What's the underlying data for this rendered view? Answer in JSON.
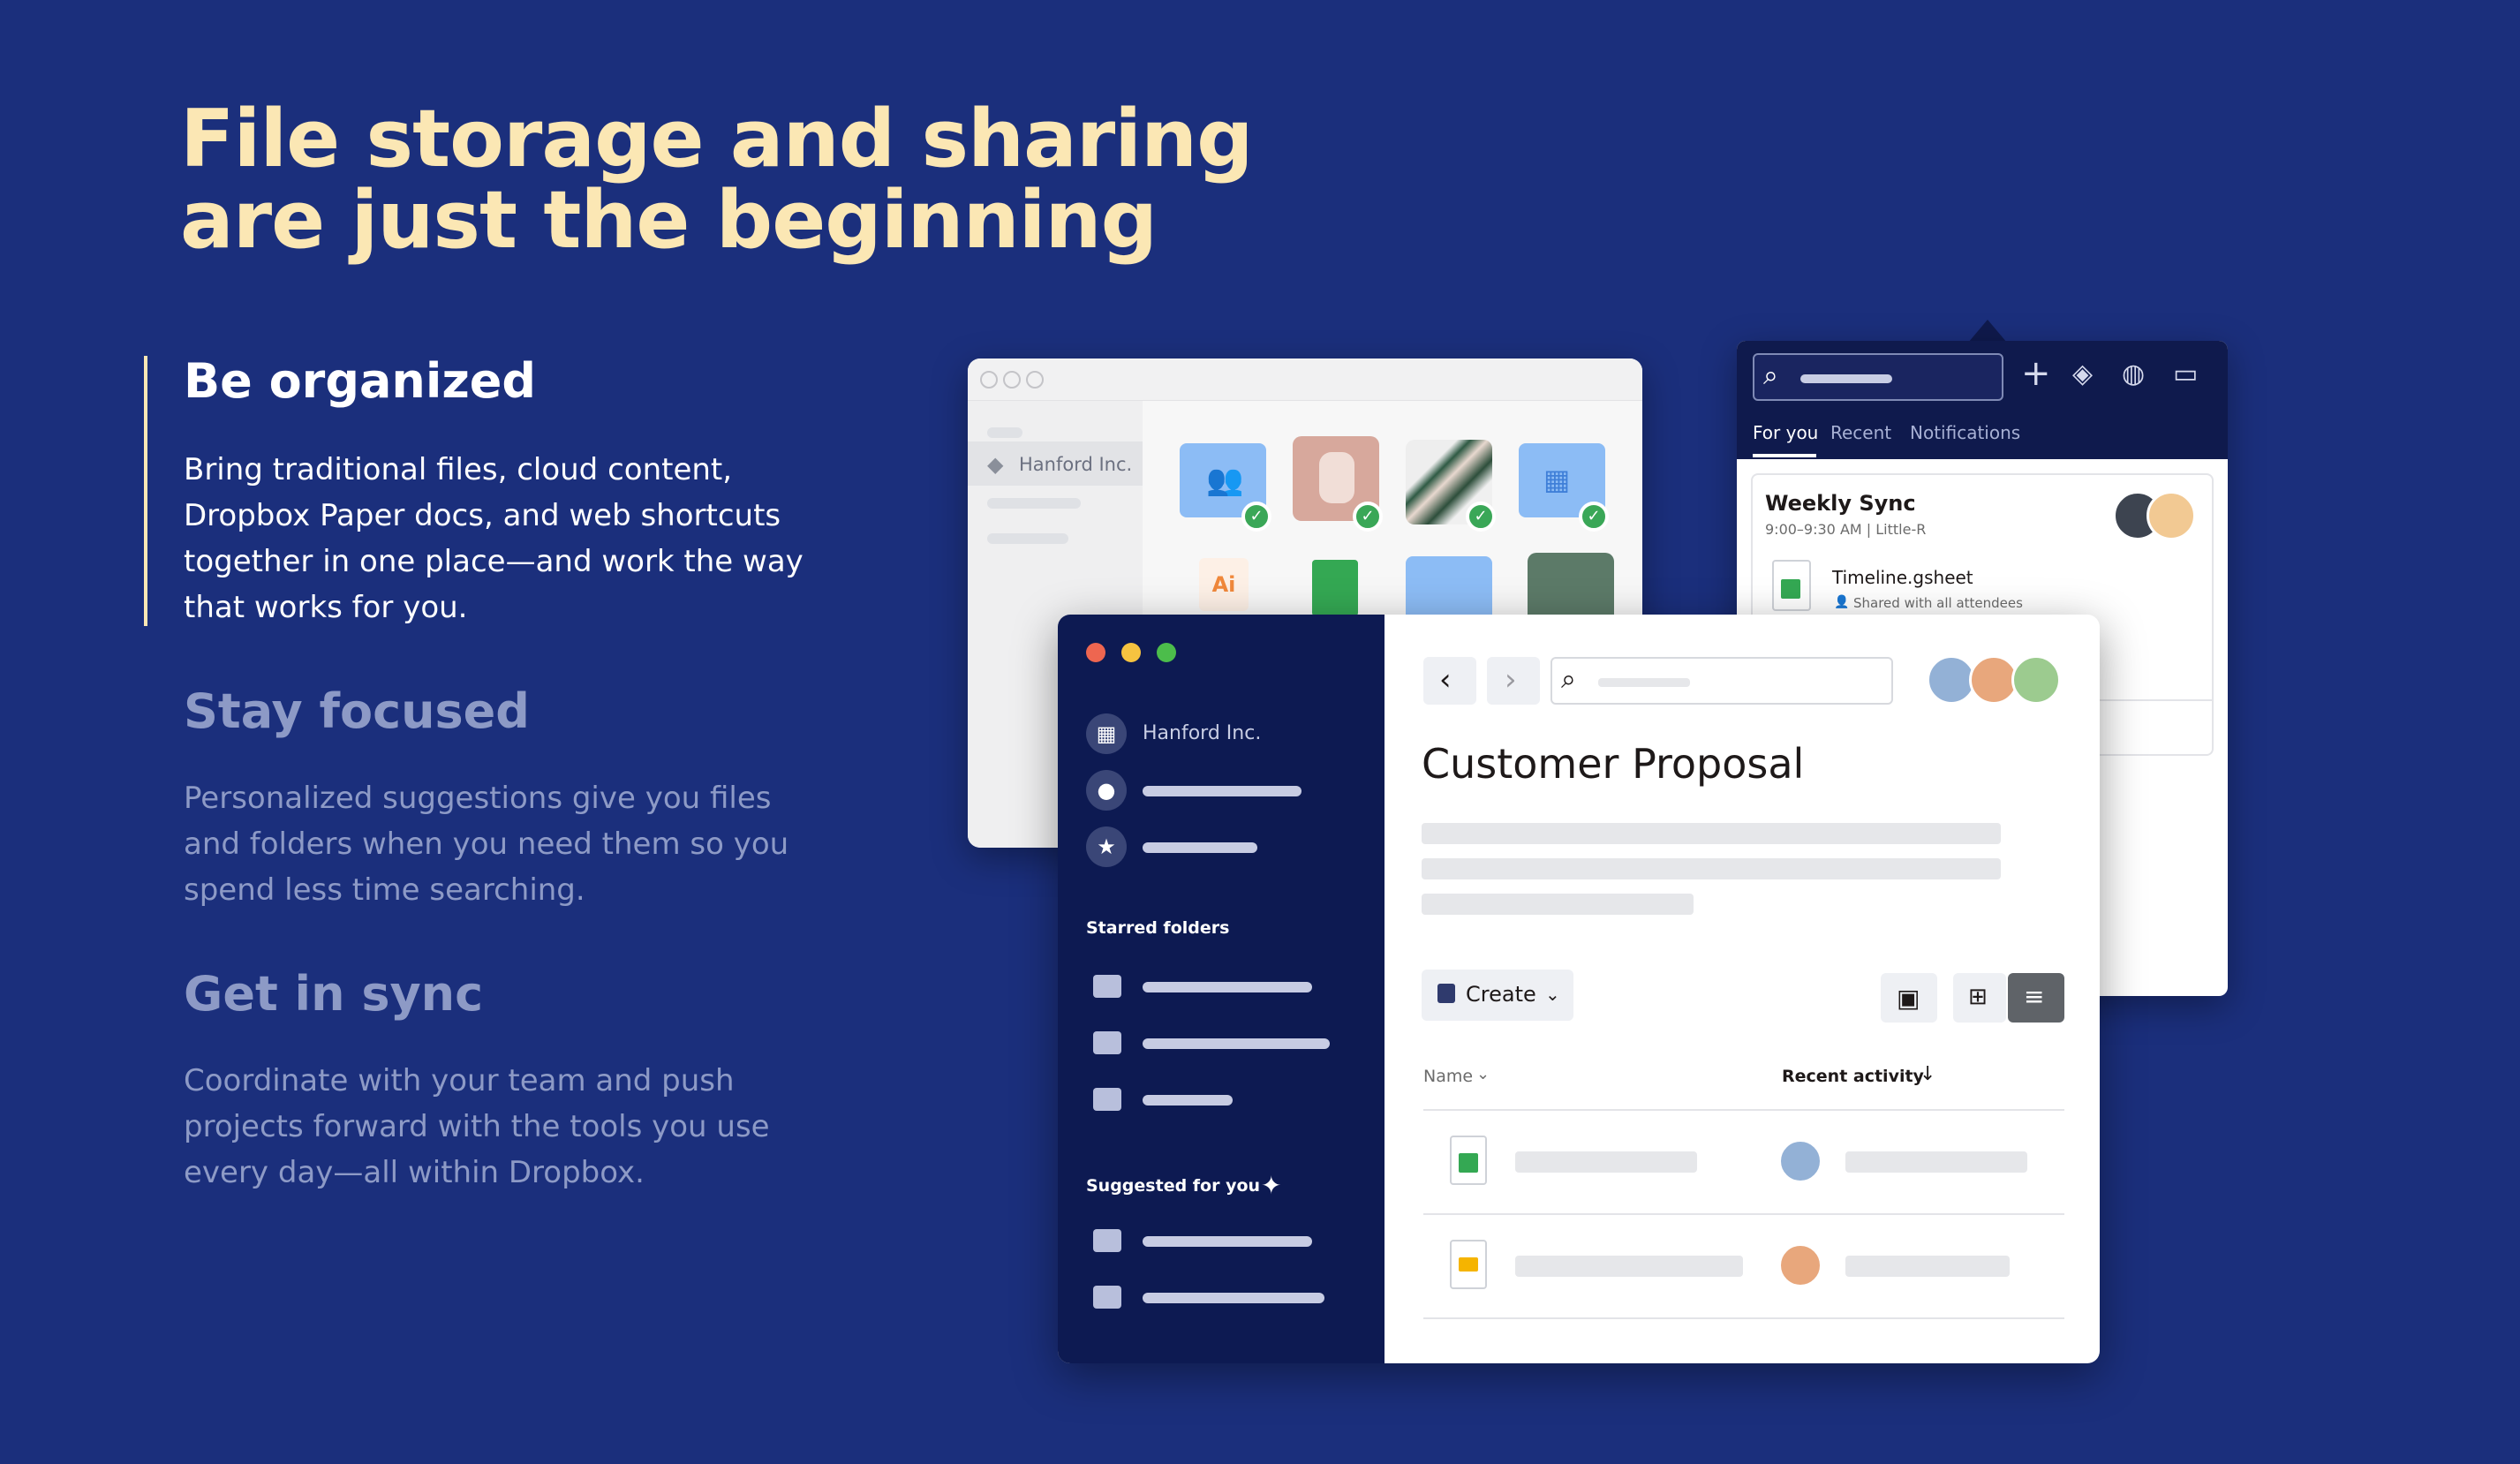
{
  "headline": "File storage and sharing are just the beginning",
  "features": [
    {
      "title": "Be organized",
      "body": "Bring traditional files, cloud content, Dropbox Paper docs, and web shortcuts together in one place—and work the way that works for you.",
      "active": true
    },
    {
      "title": "Stay focused",
      "body": "Personalized suggestions give you files and folders when you need them so you spend less time searching.",
      "active": false
    },
    {
      "title": "Get in sync",
      "body": "Coordinate with your team and push projects forward with the tools you use every day—all within Dropbox.",
      "active": false
    }
  ],
  "back_window": {
    "sidebar_item": "Hanford Inc.",
    "file_badge_ai": "Ai"
  },
  "notifications": {
    "tabs": [
      "For you",
      "Recent",
      "Notifications"
    ],
    "event_title": "Weekly Sync",
    "event_time": "9:00–9:30 AM | Little-R",
    "file_name": "Timeline.gsheet",
    "file_shared": "Shared with all attendees"
  },
  "front_window": {
    "sidebar_team": "Hanford Inc.",
    "starred_label": "Starred folders",
    "suggested_label": "Suggested for you",
    "title": "Customer Proposal",
    "create_label": "Create",
    "col_name": "Name",
    "col_activity": "Recent activity"
  },
  "colors": {
    "background": "#1b2f7c",
    "headline": "#fbe7b4",
    "sidebar": "#0d1a52",
    "check": "#3aa757"
  }
}
